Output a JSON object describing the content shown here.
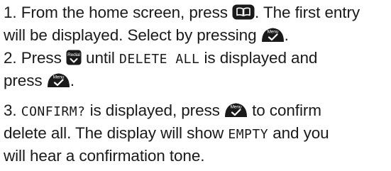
{
  "instructions": {
    "step1": {
      "a": "1. From the home screen, press",
      "b": ". The first entry",
      "c": "will be displayed. Select by pressing",
      "d": "."
    },
    "step2": {
      "a": "2. Press",
      "b": "until",
      "code": "DELETE ALL",
      "c": "is displayed and",
      "d": "press",
      "e": "."
    },
    "step3": {
      "code1": "CONFIRM?",
      "num": "3.",
      "a": "is displayed, press",
      "b": "to confirm",
      "c": "delete all. The display will show",
      "code2": "EMPTY",
      "d": "and you",
      "e": "will hear a confirmation tone."
    }
  },
  "icons": {
    "menu_label": "Menu",
    "redial_label": "Redial",
    "phonebook": "phonebook-icon",
    "menu_ok": "menu-ok-icon",
    "redial": "redial-icon"
  },
  "colors": {
    "text": "#1a1a1a",
    "icon_fill": "#1a1a1a",
    "icon_text": "#ffffff"
  }
}
